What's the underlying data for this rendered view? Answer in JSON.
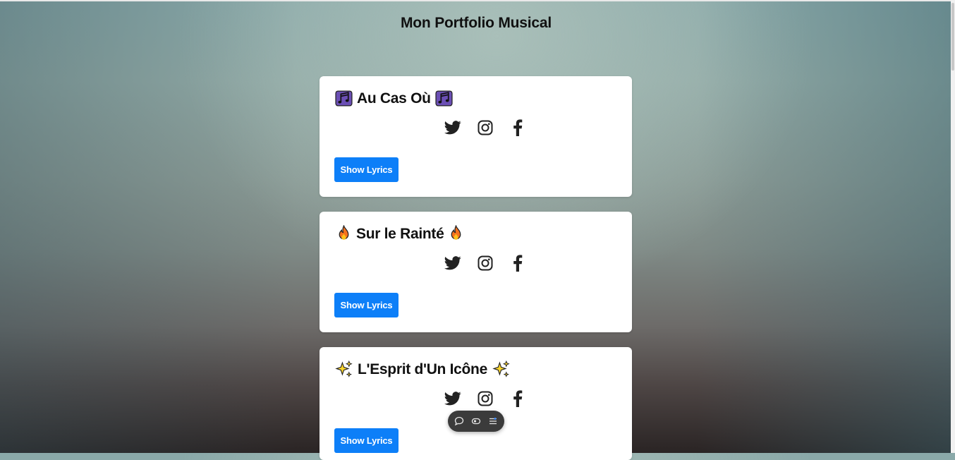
{
  "page": {
    "title": "Mon Portfolio Musical"
  },
  "songs": [
    {
      "title": "Au Cas Où",
      "emoji": "musical-notes-icon",
      "button_label": "Show Lyrics"
    },
    {
      "title": "Sur le Rainté",
      "emoji": "fire-icon",
      "button_label": "Show Lyrics"
    },
    {
      "title": "L'Esprit d'Un Icône",
      "emoji": "sparkles-icon",
      "button_label": "Show Lyrics"
    }
  ],
  "social_icons": [
    "twitter-icon",
    "instagram-icon",
    "facebook-icon"
  ],
  "floating_toolbar": {
    "icons": [
      "comment-icon",
      "eye-icon",
      "settings-sliders-icon"
    ]
  },
  "colors": {
    "button": "#0d7ff8",
    "card": "#ffffff",
    "toolbar": "#3b3b3b"
  }
}
